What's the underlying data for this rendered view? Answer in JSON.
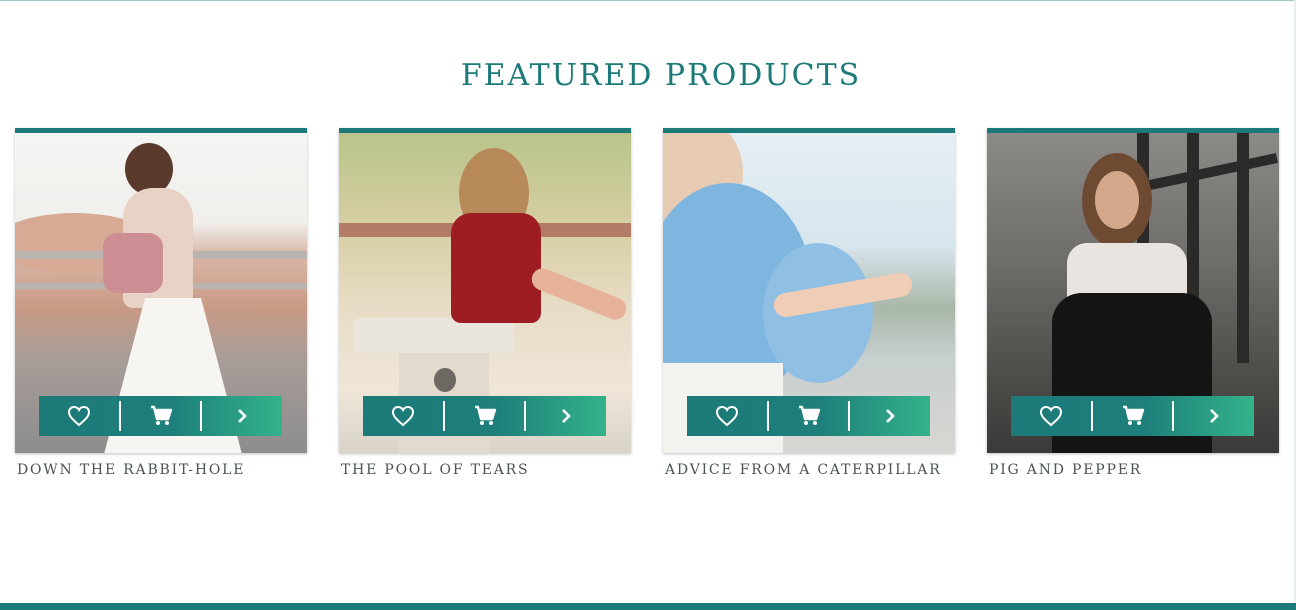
{
  "section": {
    "title": "FEATURED PRODUCTS"
  },
  "products": [
    {
      "name": "DOWN THE RABBIT-HOLE"
    },
    {
      "name": "THE POOL OF TEARS"
    },
    {
      "name": "ADVICE FROM A CATERPILLAR"
    },
    {
      "name": "PIG AND PEPPER"
    }
  ],
  "actions": {
    "wishlist_icon": "heart-icon",
    "cart_icon": "cart-icon",
    "details_icon": "chevron-right-icon"
  },
  "colors": {
    "brand": "#1c7a78",
    "gradient_end": "#33b38a",
    "text_muted": "#4b5356"
  }
}
